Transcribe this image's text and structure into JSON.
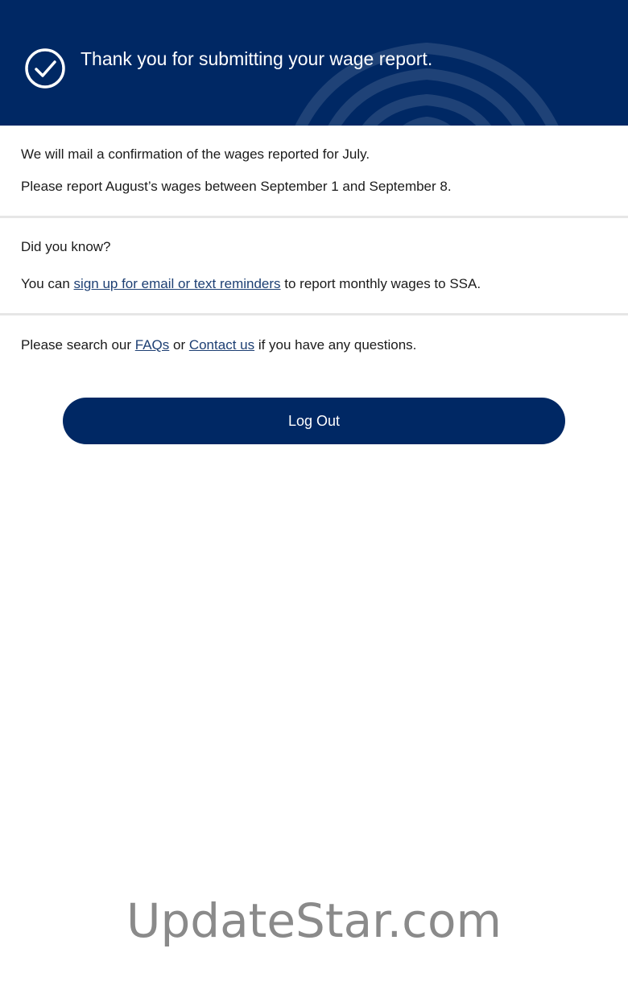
{
  "banner": {
    "title": "Thank you for submitting your wage report.",
    "icon": "check-circle-icon",
    "background_color": "#002864"
  },
  "confirmation": {
    "line1": "We will mail a confirmation of the wages reported for July.",
    "line2": "Please report August’s wages between September 1 and September 8."
  },
  "did_you_know": {
    "heading": "Did you know?",
    "prefix": "You can ",
    "link_text": "sign up for email or text reminders",
    "suffix": " to report monthly wages to SSA."
  },
  "help": {
    "prefix": "Please search our ",
    "faq_link": "FAQs",
    "middle": " or ",
    "contact_link": "Contact us",
    "suffix": " if you have any questions."
  },
  "actions": {
    "logout_label": "Log Out"
  },
  "watermark": {
    "text": "UpdateStar.com"
  },
  "colors": {
    "primary": "#002864",
    "link": "#1d3f73",
    "divider": "#e6e6e6"
  }
}
